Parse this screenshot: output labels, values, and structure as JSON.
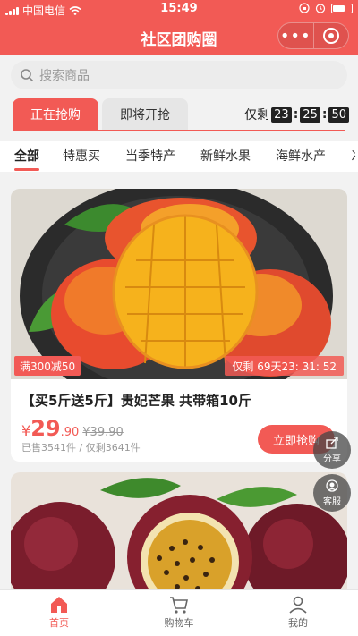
{
  "status_bar": {
    "carrier": "中国电信",
    "time": "15:49"
  },
  "nav": {
    "title": "社区团购圈",
    "more_icon": "more-dots-icon",
    "close_icon": "close-target-icon"
  },
  "search": {
    "placeholder": "搜索商品"
  },
  "tabs": [
    {
      "label": "正在抢购",
      "active": true
    },
    {
      "label": "即将开抢",
      "active": false
    }
  ],
  "countdown": {
    "prefix": "仅剩",
    "hours": "23",
    "minutes": "25",
    "seconds": "50"
  },
  "categories": [
    "全部",
    "特惠买",
    "当季特产",
    "新鲜水果",
    "海鲜水产"
  ],
  "products": [
    {
      "promo": "满300减50",
      "remaining": "仅剩 69天23: 31: 52",
      "title": "【买5斤送5斤】贵妃芒果 共带箱10斤",
      "price_symbol": "¥",
      "price_int": "29",
      "price_dec": ".90",
      "orig_price": "¥39.90",
      "sold": "已售3541件 / 仅剩3641件",
      "buy_label": "立即抢购"
    }
  ],
  "float_buttons": {
    "share": "分享",
    "service": "客服"
  },
  "tab_bar": [
    {
      "label": "首页",
      "icon": "home-icon",
      "active": true
    },
    {
      "label": "购物车",
      "icon": "cart-icon",
      "active": false
    },
    {
      "label": "我的",
      "icon": "user-icon",
      "active": false
    }
  ],
  "colors": {
    "brand": "#f25a55",
    "price": "#f25a55"
  }
}
